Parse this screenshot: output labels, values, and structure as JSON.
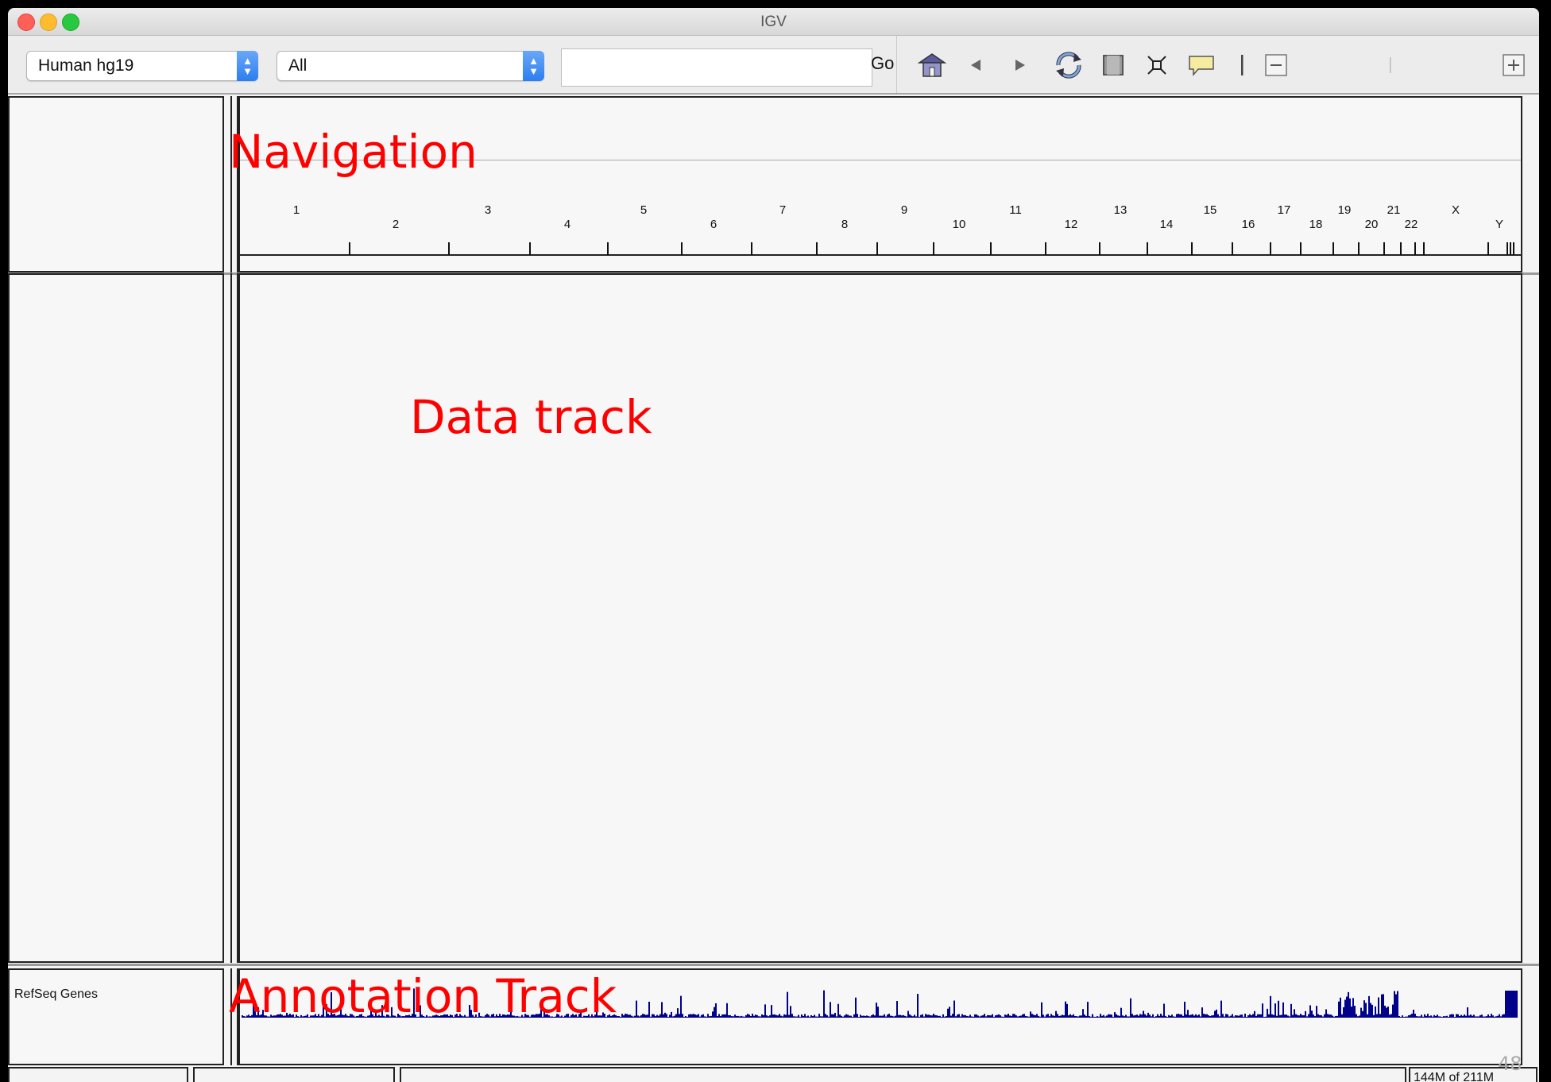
{
  "window": {
    "title": "IGV"
  },
  "toolbar": {
    "genome": "Human hg19",
    "chromosome": "All",
    "locus_value": "",
    "go_label": "Go",
    "icons": [
      "home-icon",
      "back-arrow-icon",
      "forward-arrow-icon",
      "refresh-icon",
      "roi-icon",
      "resize-icon",
      "popup-info-icon",
      "zoom-out-icon",
      "zoom-in-icon"
    ]
  },
  "ruler": {
    "chromosomes": [
      "1",
      "2",
      "3",
      "4",
      "5",
      "6",
      "7",
      "8",
      "9",
      "10",
      "11",
      "12",
      "13",
      "14",
      "15",
      "16",
      "17",
      "18",
      "19",
      "20",
      "21",
      "22",
      "X",
      "Y"
    ]
  },
  "tracks": {
    "annotation_name": "RefSeq Genes"
  },
  "overlays": {
    "navigation": "Navigation",
    "data_track": "Data track",
    "annotation_track": "Annotation Track"
  },
  "status": {
    "memory": "144M of 211M"
  },
  "slide": {
    "page_number": "48"
  },
  "colors": {
    "overlay_text": "#ff0000",
    "feature": "#00008b",
    "window_bg": "#f4f4f4"
  }
}
